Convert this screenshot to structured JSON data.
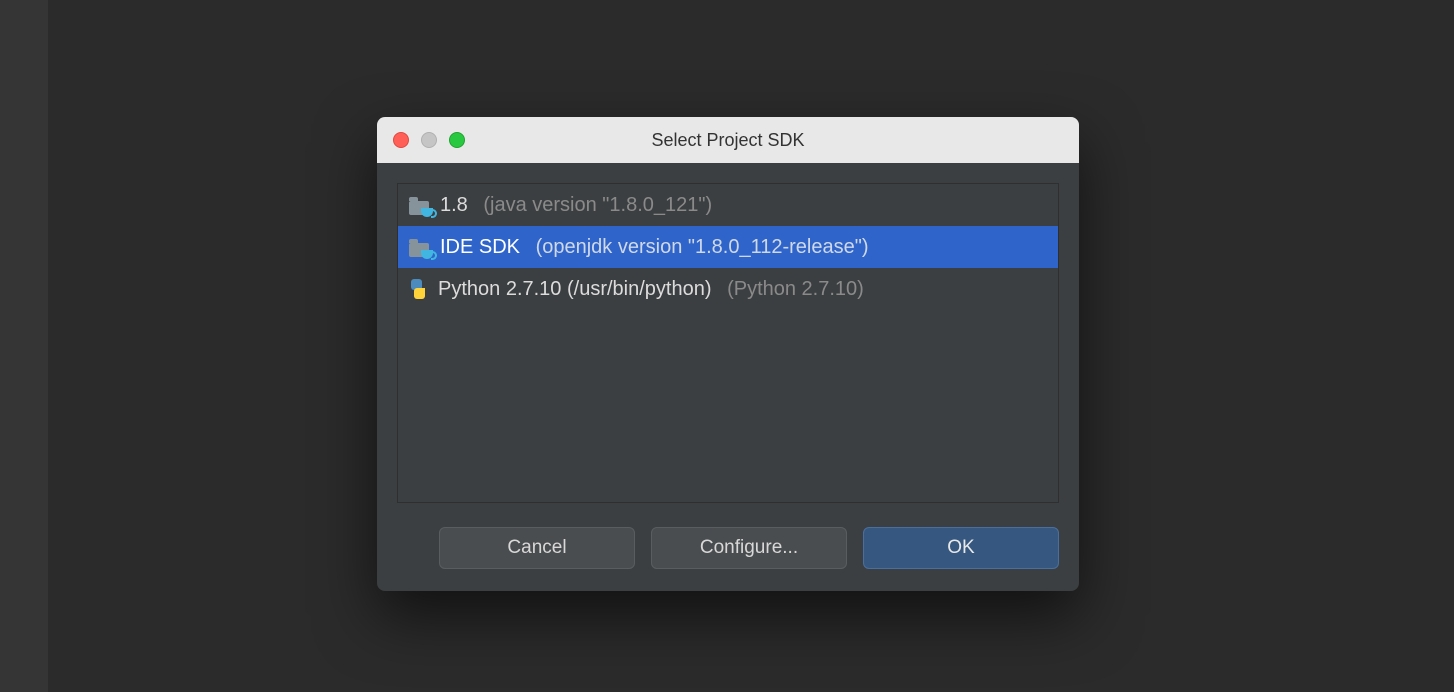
{
  "dialog": {
    "title": "Select Project SDK",
    "sdks": [
      {
        "icon": "java-folder-icon",
        "name": "1.8",
        "detail": "(java version \"1.8.0_121\")",
        "selected": false
      },
      {
        "icon": "java-folder-icon",
        "name": "IDE SDK",
        "detail": "(openjdk version \"1.8.0_112-release\")",
        "selected": true
      },
      {
        "icon": "python-icon",
        "name": "Python 2.7.10 (/usr/bin/python)",
        "detail": "(Python 2.7.10)",
        "selected": false
      }
    ],
    "buttons": {
      "cancel": "Cancel",
      "configure": "Configure...",
      "ok": "OK"
    }
  }
}
